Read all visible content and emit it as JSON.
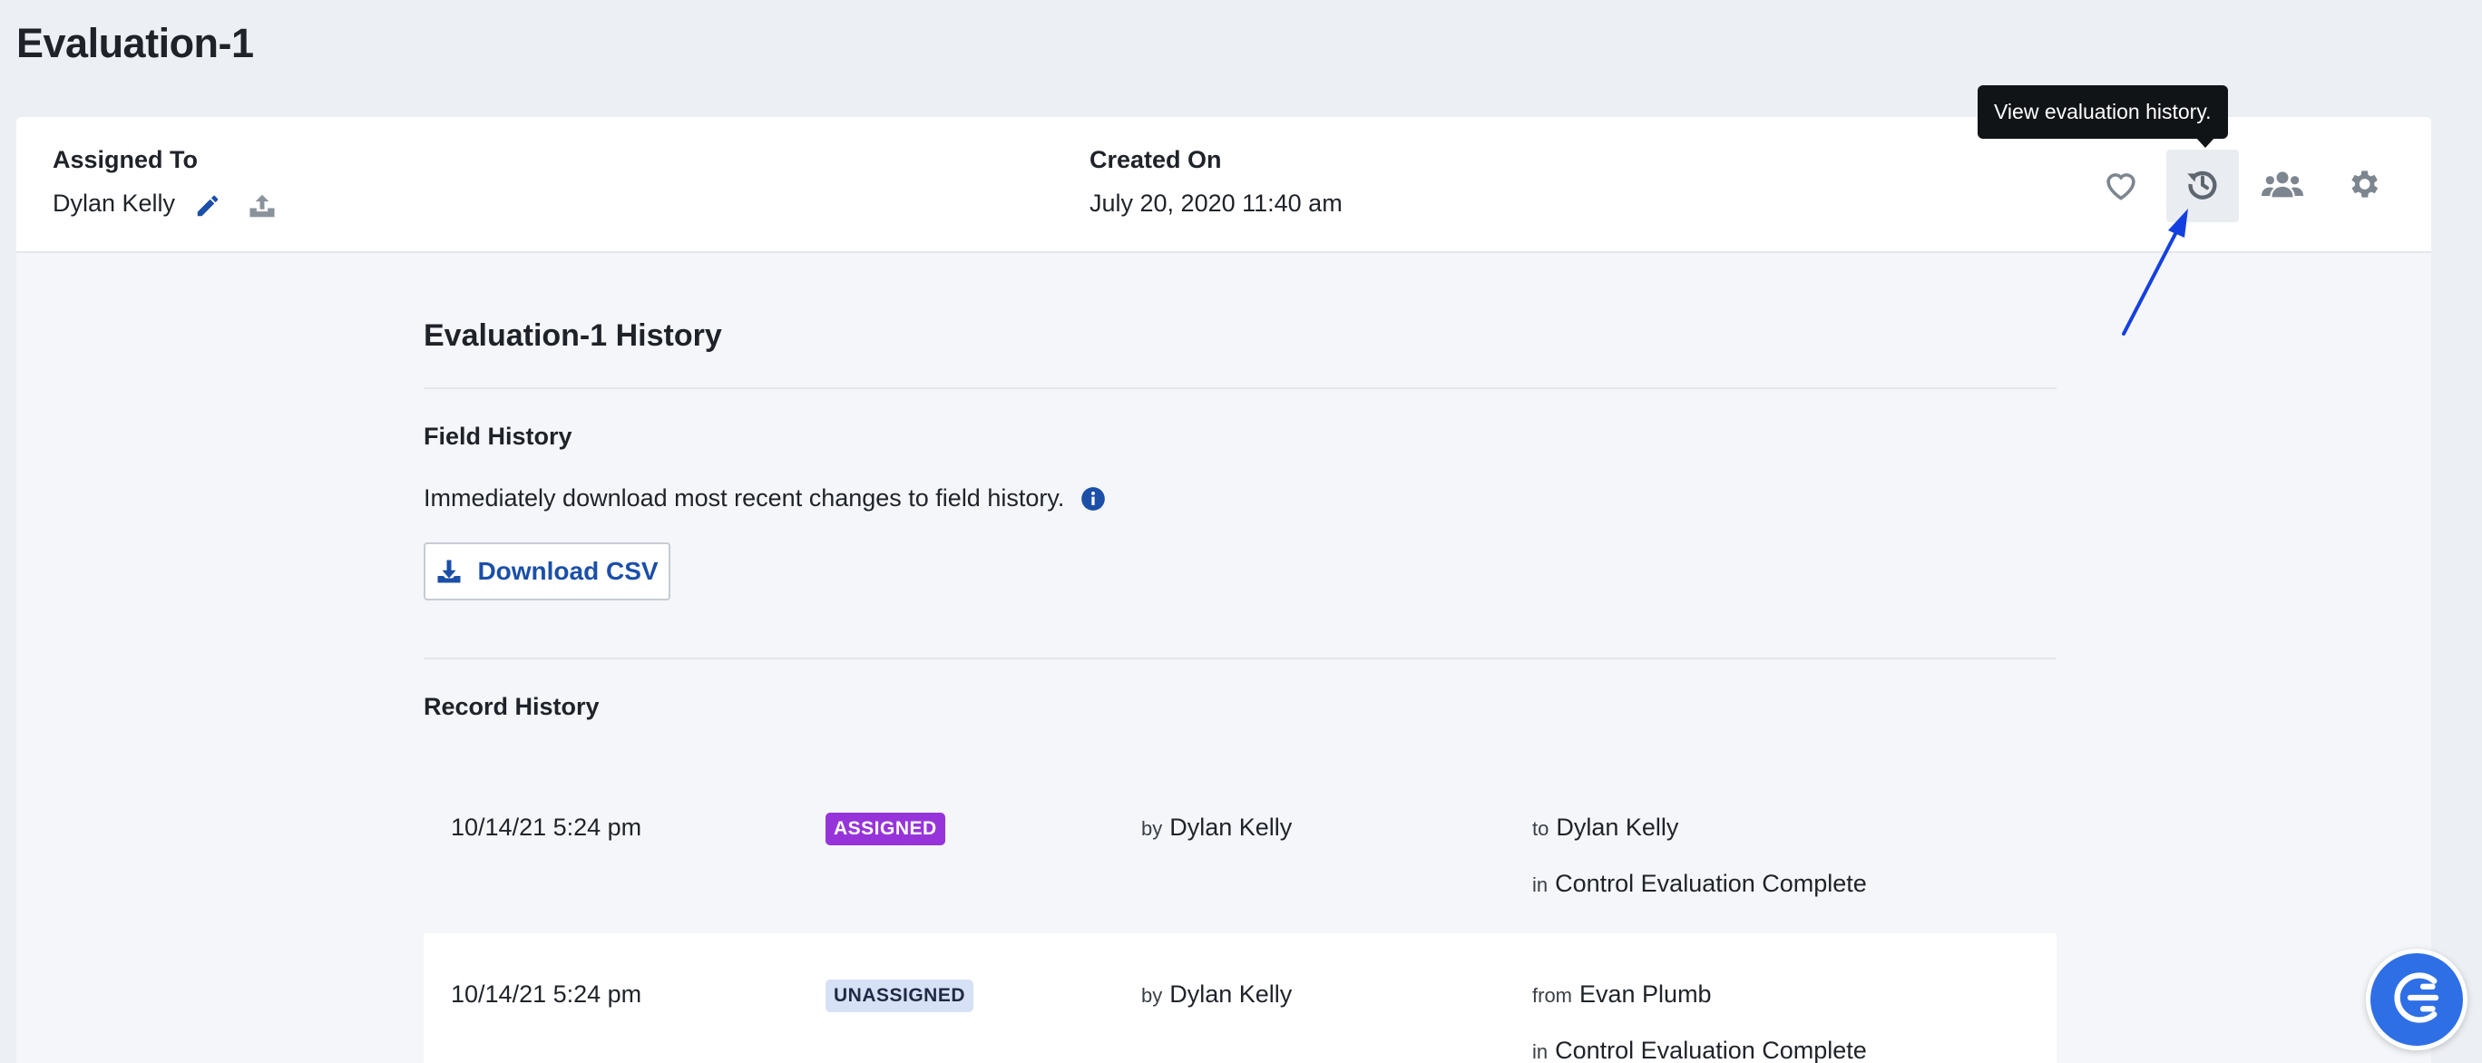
{
  "page": {
    "title": "Evaluation-1"
  },
  "header": {
    "assigned_to_label": "Assigned To",
    "assigned_to_value": "Dylan Kelly",
    "created_on_label": "Created On",
    "created_on_value": "July 20, 2020 11:40 am",
    "actions": [
      {
        "name": "favorite",
        "icon": "heart-icon"
      },
      {
        "name": "history",
        "icon": "history-icon",
        "active": true
      },
      {
        "name": "users",
        "icon": "users-icon"
      },
      {
        "name": "settings",
        "icon": "gear-icon"
      }
    ],
    "tooltip": "View evaluation history."
  },
  "history": {
    "title": "Evaluation-1 History",
    "field_history_title": "Field History",
    "field_history_desc": "Immediately download most recent changes to field history.",
    "download_label": "Download CSV",
    "record_history_title": "Record History",
    "records": [
      {
        "date": "10/14/21 5:24 pm",
        "status": "ASSIGNED",
        "by_prefix": "by",
        "by": "Dylan Kelly",
        "target_prefix": "to",
        "target": "Dylan Kelly",
        "in_prefix": "in",
        "in": "Control Evaluation Complete"
      },
      {
        "date": "10/14/21 5:24 pm",
        "status": "UNASSIGNED",
        "by_prefix": "by",
        "by": "Dylan Kelly",
        "target_prefix": "from",
        "target": "Evan Plumb",
        "in_prefix": "in",
        "in": "Control Evaluation Complete"
      }
    ]
  },
  "colors": {
    "accent": "#1b4fa8",
    "assigned_badge": "#9734d9",
    "unassigned_badge": "#d7e1f6",
    "annotation_arrow": "#1440e0",
    "fab": "#2f6fe6"
  }
}
